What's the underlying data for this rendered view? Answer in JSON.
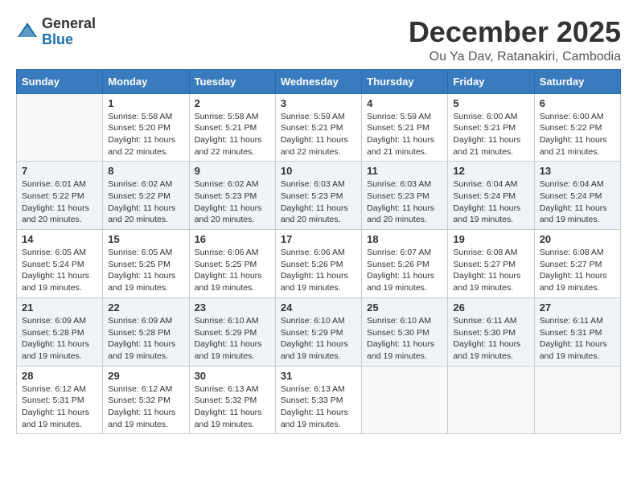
{
  "logo": {
    "general": "General",
    "blue": "Blue"
  },
  "title": "December 2025",
  "location": "Ou Ya Dav, Ratanakiri, Cambodia",
  "days_header": [
    "Sunday",
    "Monday",
    "Tuesday",
    "Wednesday",
    "Thursday",
    "Friday",
    "Saturday"
  ],
  "weeks": [
    [
      {
        "day": "",
        "info": ""
      },
      {
        "day": "1",
        "info": "Sunrise: 5:58 AM\nSunset: 5:20 PM\nDaylight: 11 hours\nand 22 minutes."
      },
      {
        "day": "2",
        "info": "Sunrise: 5:58 AM\nSunset: 5:21 PM\nDaylight: 11 hours\nand 22 minutes."
      },
      {
        "day": "3",
        "info": "Sunrise: 5:59 AM\nSunset: 5:21 PM\nDaylight: 11 hours\nand 22 minutes."
      },
      {
        "day": "4",
        "info": "Sunrise: 5:59 AM\nSunset: 5:21 PM\nDaylight: 11 hours\nand 21 minutes."
      },
      {
        "day": "5",
        "info": "Sunrise: 6:00 AM\nSunset: 5:21 PM\nDaylight: 11 hours\nand 21 minutes."
      },
      {
        "day": "6",
        "info": "Sunrise: 6:00 AM\nSunset: 5:22 PM\nDaylight: 11 hours\nand 21 minutes."
      }
    ],
    [
      {
        "day": "7",
        "info": "Sunrise: 6:01 AM\nSunset: 5:22 PM\nDaylight: 11 hours\nand 20 minutes."
      },
      {
        "day": "8",
        "info": "Sunrise: 6:02 AM\nSunset: 5:22 PM\nDaylight: 11 hours\nand 20 minutes."
      },
      {
        "day": "9",
        "info": "Sunrise: 6:02 AM\nSunset: 5:23 PM\nDaylight: 11 hours\nand 20 minutes."
      },
      {
        "day": "10",
        "info": "Sunrise: 6:03 AM\nSunset: 5:23 PM\nDaylight: 11 hours\nand 20 minutes."
      },
      {
        "day": "11",
        "info": "Sunrise: 6:03 AM\nSunset: 5:23 PM\nDaylight: 11 hours\nand 20 minutes."
      },
      {
        "day": "12",
        "info": "Sunrise: 6:04 AM\nSunset: 5:24 PM\nDaylight: 11 hours\nand 19 minutes."
      },
      {
        "day": "13",
        "info": "Sunrise: 6:04 AM\nSunset: 5:24 PM\nDaylight: 11 hours\nand 19 minutes."
      }
    ],
    [
      {
        "day": "14",
        "info": "Sunrise: 6:05 AM\nSunset: 5:24 PM\nDaylight: 11 hours\nand 19 minutes."
      },
      {
        "day": "15",
        "info": "Sunrise: 6:05 AM\nSunset: 5:25 PM\nDaylight: 11 hours\nand 19 minutes."
      },
      {
        "day": "16",
        "info": "Sunrise: 6:06 AM\nSunset: 5:25 PM\nDaylight: 11 hours\nand 19 minutes."
      },
      {
        "day": "17",
        "info": "Sunrise: 6:06 AM\nSunset: 5:26 PM\nDaylight: 11 hours\nand 19 minutes."
      },
      {
        "day": "18",
        "info": "Sunrise: 6:07 AM\nSunset: 5:26 PM\nDaylight: 11 hours\nand 19 minutes."
      },
      {
        "day": "19",
        "info": "Sunrise: 6:08 AM\nSunset: 5:27 PM\nDaylight: 11 hours\nand 19 minutes."
      },
      {
        "day": "20",
        "info": "Sunrise: 6:08 AM\nSunset: 5:27 PM\nDaylight: 11 hours\nand 19 minutes."
      }
    ],
    [
      {
        "day": "21",
        "info": "Sunrise: 6:09 AM\nSunset: 5:28 PM\nDaylight: 11 hours\nand 19 minutes."
      },
      {
        "day": "22",
        "info": "Sunrise: 6:09 AM\nSunset: 5:28 PM\nDaylight: 11 hours\nand 19 minutes."
      },
      {
        "day": "23",
        "info": "Sunrise: 6:10 AM\nSunset: 5:29 PM\nDaylight: 11 hours\nand 19 minutes."
      },
      {
        "day": "24",
        "info": "Sunrise: 6:10 AM\nSunset: 5:29 PM\nDaylight: 11 hours\nand 19 minutes."
      },
      {
        "day": "25",
        "info": "Sunrise: 6:10 AM\nSunset: 5:30 PM\nDaylight: 11 hours\nand 19 minutes."
      },
      {
        "day": "26",
        "info": "Sunrise: 6:11 AM\nSunset: 5:30 PM\nDaylight: 11 hours\nand 19 minutes."
      },
      {
        "day": "27",
        "info": "Sunrise: 6:11 AM\nSunset: 5:31 PM\nDaylight: 11 hours\nand 19 minutes."
      }
    ],
    [
      {
        "day": "28",
        "info": "Sunrise: 6:12 AM\nSunset: 5:31 PM\nDaylight: 11 hours\nand 19 minutes."
      },
      {
        "day": "29",
        "info": "Sunrise: 6:12 AM\nSunset: 5:32 PM\nDaylight: 11 hours\nand 19 minutes."
      },
      {
        "day": "30",
        "info": "Sunrise: 6:13 AM\nSunset: 5:32 PM\nDaylight: 11 hours\nand 19 minutes."
      },
      {
        "day": "31",
        "info": "Sunrise: 6:13 AM\nSunset: 5:33 PM\nDaylight: 11 hours\nand 19 minutes."
      },
      {
        "day": "",
        "info": ""
      },
      {
        "day": "",
        "info": ""
      },
      {
        "day": "",
        "info": ""
      }
    ]
  ]
}
